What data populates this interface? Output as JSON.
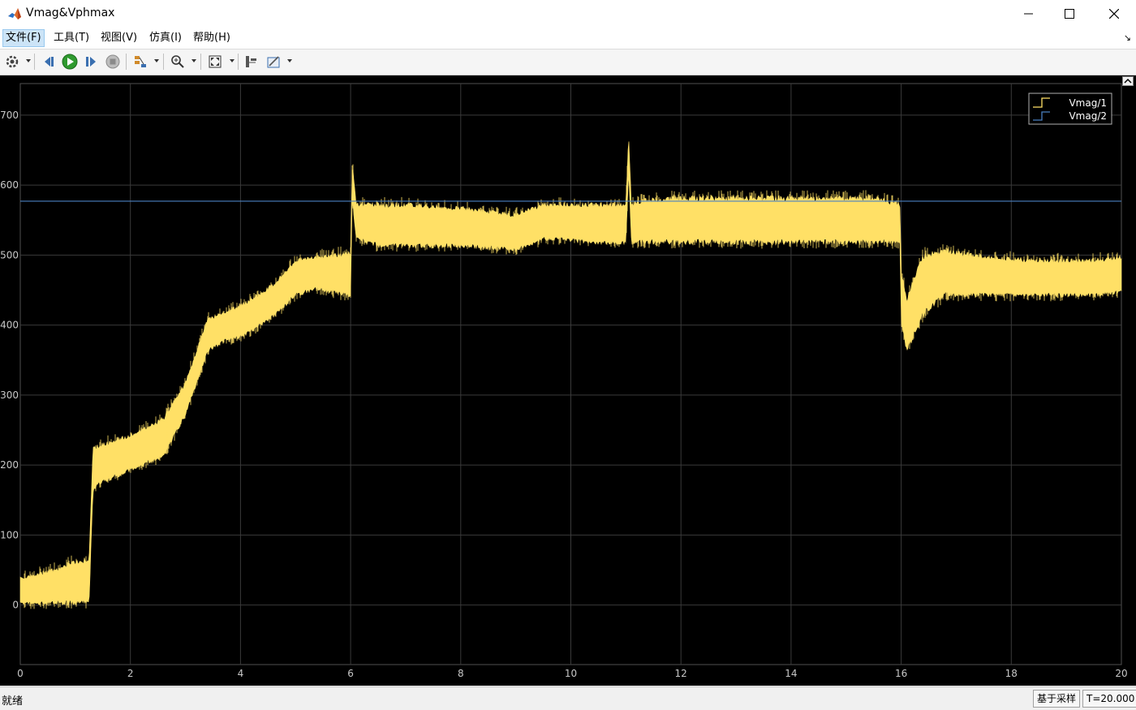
{
  "window": {
    "title": "Vmag&Vphmax"
  },
  "menu": [
    {
      "label": "文件(F)",
      "active": true
    },
    {
      "label": "工具(T)"
    },
    {
      "label": "视图(V)"
    },
    {
      "label": "仿真(I)"
    },
    {
      "label": "帮助(H)"
    }
  ],
  "toolbar": [
    "settings-icon",
    "stop-back-icon",
    "run-icon",
    "step-forward-icon",
    "stop-icon",
    "signal-selector-icon",
    "zoom-icon",
    "fit-to-view-icon",
    "cursor-measure-icon",
    "style-icon"
  ],
  "status": {
    "text": "就绪",
    "sample_mode": "基于采样",
    "time": "T=20.000"
  },
  "colors": {
    "series1": "#ffe066",
    "series2": "#4a7fc0",
    "grid": "#3a3a3a",
    "axis_text": "#c8c8c8"
  },
  "chart_data": {
    "type": "line",
    "xlim": [
      0,
      20
    ],
    "ylim": [
      -85,
      745
    ],
    "xticks": [
      0,
      2,
      4,
      6,
      8,
      10,
      12,
      14,
      16,
      18,
      20
    ],
    "yticks": [
      0,
      100,
      200,
      300,
      400,
      500,
      600,
      700
    ],
    "grid": true,
    "legend_position": "top-right",
    "series": [
      {
        "name": "Vmag/1",
        "style": "noisy-band",
        "x": [
          0,
          0.5,
          1.0,
          1.25,
          1.32,
          1.4,
          2.0,
          2.6,
          3.0,
          3.4,
          3.7,
          4.0,
          4.6,
          5.0,
          5.4,
          5.9,
          6.0,
          6.03,
          6.1,
          6.5,
          7.0,
          8.0,
          9.0,
          9.5,
          9.8,
          10.5,
          11.0,
          11.05,
          11.1,
          11.2,
          12.0,
          14.0,
          15.5,
          15.98,
          16.0,
          16.1,
          16.4,
          16.8,
          17.5,
          18.5,
          19.5,
          20.0
        ],
        "low": [
          0,
          0,
          0,
          0,
          160,
          170,
          190,
          210,
          270,
          360,
          375,
          380,
          410,
          440,
          450,
          440,
          440,
          580,
          520,
          510,
          510,
          510,
          505,
          520,
          520,
          515,
          515,
          620,
          515,
          515,
          515,
          515,
          515,
          515,
          400,
          360,
          410,
          440,
          440,
          440,
          440,
          445
        ],
        "high": [
          40,
          50,
          65,
          70,
          225,
          230,
          245,
          270,
          320,
          410,
          420,
          430,
          460,
          495,
          500,
          505,
          505,
          635,
          575,
          575,
          575,
          570,
          560,
          575,
          575,
          575,
          575,
          675,
          575,
          580,
          585,
          585,
          585,
          575,
          480,
          440,
          505,
          510,
          500,
          495,
          495,
          500
        ]
      },
      {
        "name": "Vmag/2",
        "style": "line",
        "x": [
          0,
          20
        ],
        "y": [
          577,
          577
        ]
      }
    ]
  }
}
